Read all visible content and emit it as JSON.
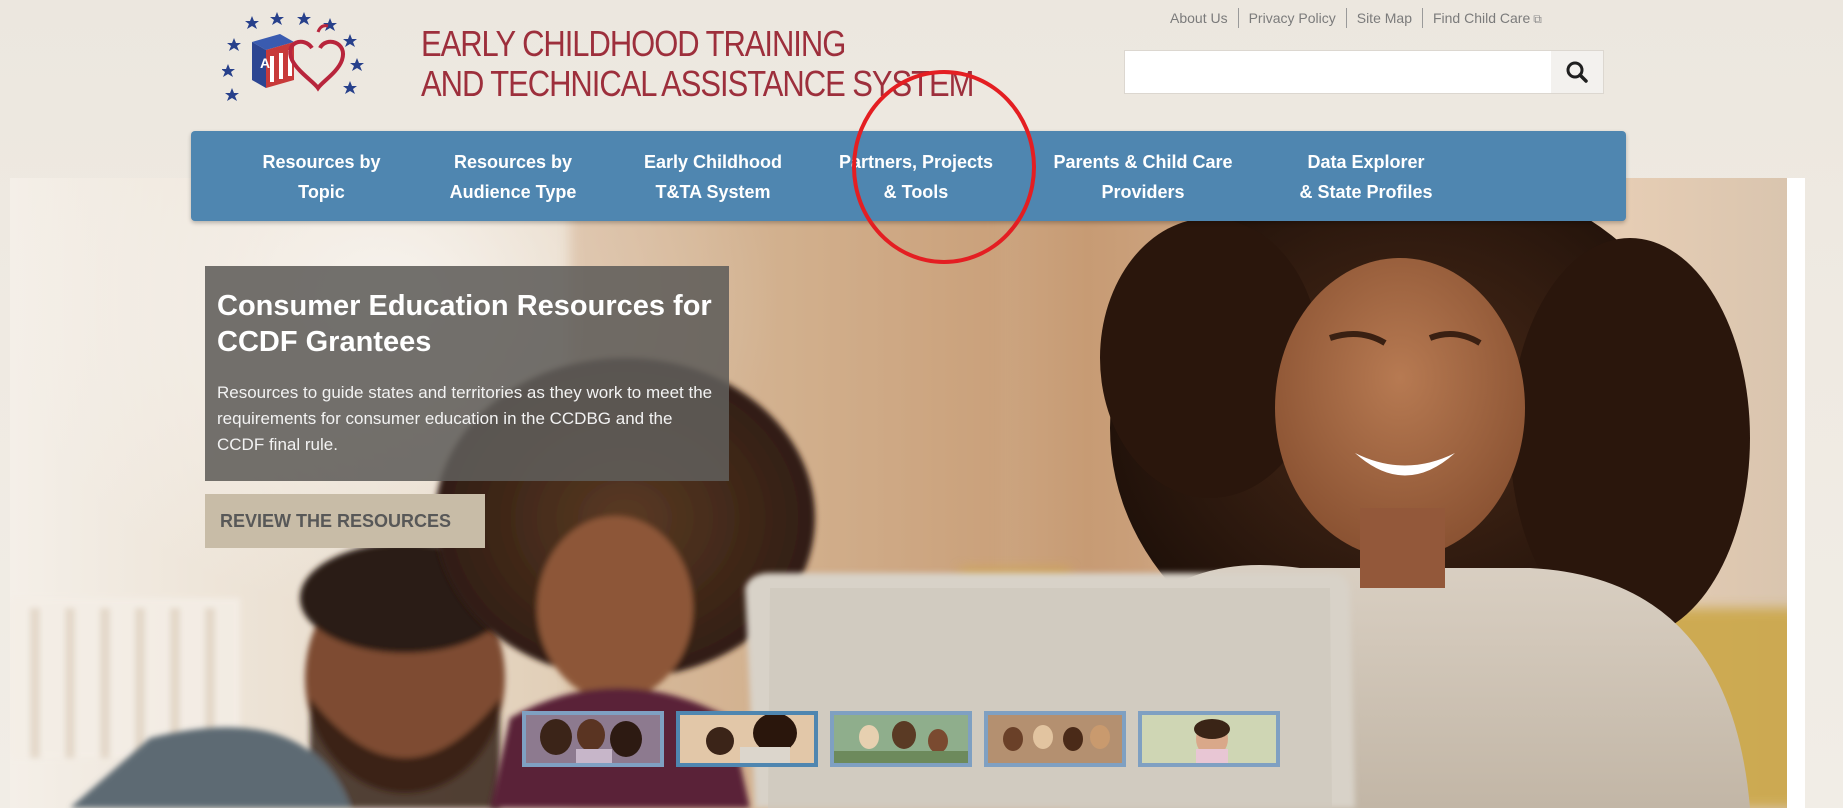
{
  "header": {
    "title_line1": "EARLY CHILDHOOD TRAINING",
    "title_line2": "AND TECHNICAL ASSISTANCE SYSTEM",
    "logo_icon": "abc-block-heart-stars-logo"
  },
  "utility_nav": {
    "about": "About Us",
    "privacy": "Privacy Policy",
    "sitemap": "Site Map",
    "find_child_care": "Find Child Care",
    "external_icon": "external-link-icon"
  },
  "search": {
    "value": "",
    "placeholder": "",
    "icon": "search-icon"
  },
  "main_nav": {
    "items": [
      {
        "label": "Resources by\nTopic"
      },
      {
        "label": "Resources by\nAudience Type"
      },
      {
        "label": "Early Childhood\nT&TA System"
      },
      {
        "label": "Partners, Projects\n& Tools"
      },
      {
        "label": "Parents & Child Care\nProviders"
      },
      {
        "label": "Data Explorer\n& State Profiles"
      }
    ]
  },
  "feature": {
    "title": "Consumer Education Resources for CCDF Grantees",
    "body": "Resources to guide states and territories as they work to meet the requirements for consumer education in the CCDBG and the CCDF final rule.",
    "cta_label": "REVIEW THE RESOURCES"
  },
  "carousel": {
    "active_index": 1,
    "slide_count": 5
  },
  "colors": {
    "brand_red": "#9d2f3c",
    "nav_blue": "#4f86b0",
    "annotation_red": "#e41e22"
  }
}
